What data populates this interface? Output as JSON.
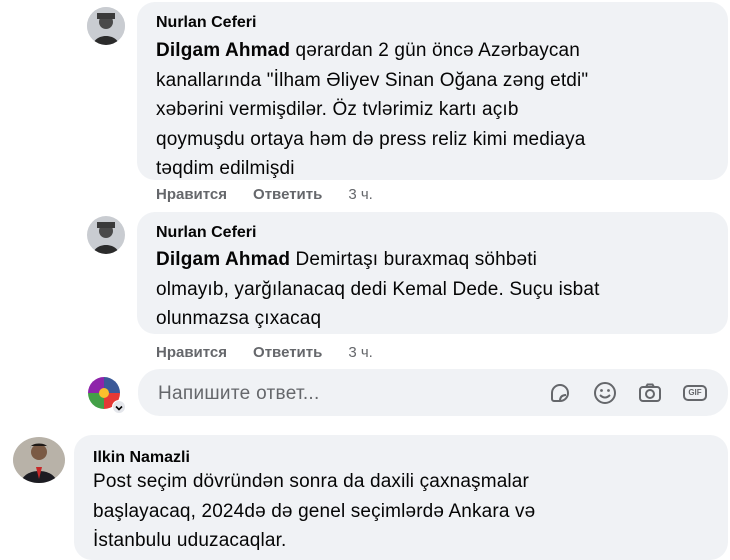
{
  "comments": [
    {
      "author": "Nurlan Ceferi",
      "mention": "Dilgam Ahmad",
      "lines": [
        " qərardan 2 gün öncə Azərbaycan",
        "kanallarında \"İlham Əliyev Sinan Oğana zəng etdi\"",
        "xəbərini vermişdilər. Öz tvlərimiz kartı açıb",
        "qoymuşdu ortaya həm də press reliz kimi mediaya",
        "təqdim edilmişdi"
      ],
      "like": "Нравится",
      "reply": "Ответить",
      "time": "3 ч."
    },
    {
      "author": "Nurlan Ceferi",
      "mention": "Dilgam Ahmad",
      "lines": [
        " Demirtaşı buraxmaq söhbəti",
        "olmayıb, yarğılanacaq dedi Kemal Dede. Suçu isbat",
        "olunmazsa çıxacaq"
      ],
      "like": "Нравится",
      "reply": "Ответить",
      "time": "3 ч."
    },
    {
      "author": "Ilkin Namazli",
      "lines": [
        "Post seçim dövründən sonra da daxili çaxnaşmalar",
        "başlayacaq, 2024də də genel seçimlərdə Ankara və",
        "İstanbulu uduzacaqlar."
      ]
    }
  ],
  "reply_box": {
    "placeholder": "Напишите ответ...",
    "icons": [
      "sticker-icon",
      "emoji-icon",
      "camera-icon",
      "gif-icon"
    ],
    "gif_label": "GIF"
  },
  "colors": {
    "bubble": "#f0f2f5",
    "secondary_text": "#65676b",
    "primary_text": "#050505"
  }
}
